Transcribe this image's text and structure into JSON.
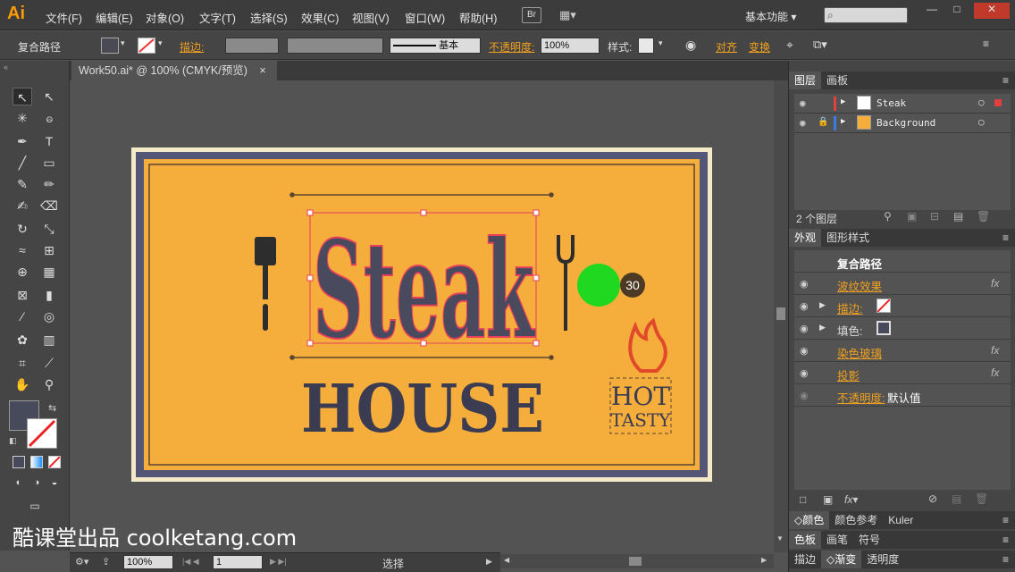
{
  "app": {
    "logo": "Ai",
    "document_tab": "Work50.ai* @ 100% (CMYK/预览)",
    "tab_close": "×"
  },
  "menu": [
    "文件(F)",
    "编辑(E)",
    "对象(O)",
    "文字(T)",
    "选择(S)",
    "效果(C)",
    "视图(V)",
    "窗口(W)",
    "帮助(H)"
  ],
  "menubar": {
    "bridge": "Br",
    "workspace": "基本功能",
    "search_placeholder": "",
    "min": "—",
    "max": "□",
    "close": "✕"
  },
  "control": {
    "selection_type": "复合路径",
    "stroke_label": "描边:",
    "stroke_profile": "基本",
    "opacity_label": "不透明度:",
    "opacity_value": "100%",
    "style_label": "样式:",
    "align_label": "对齐",
    "transform_label": "变换"
  },
  "artwork": {
    "title_word": "Steak",
    "subtitle": "HOUSE",
    "badge_line1": "HOT",
    "badge_line2": "TASTY"
  },
  "cursor_badge": "30",
  "colors": {
    "artboard_bg": "#f4e9c8",
    "poster_orange": "#f5ad3c",
    "poster_border": "#545675",
    "ink": "#3b3b52",
    "selection": "#e8405a",
    "cursor_green": "#1fd81f"
  },
  "statusbar": {
    "zoom": "100%",
    "page": "1",
    "mode": "选择"
  },
  "layers_panel": {
    "tabs": [
      "图层",
      "画板"
    ],
    "layers": [
      {
        "name": "Steak",
        "color": "#e04040"
      },
      {
        "name": "Background",
        "color": "#3a7ce0"
      }
    ],
    "count": "2 个图层"
  },
  "appearance_panel": {
    "tabs": [
      "外观",
      "图形样式"
    ],
    "header": "复合路径",
    "rows": [
      {
        "label": "波纹效果",
        "value": ""
      },
      {
        "label": "描边:",
        "value": ""
      },
      {
        "label": "填色:",
        "value": ""
      },
      {
        "label": "染色玻璃",
        "value": ""
      },
      {
        "label": "投影",
        "value": ""
      },
      {
        "label": "不透明度:",
        "value": "默认值"
      }
    ],
    "fx": "fx"
  },
  "collapsed_panels": [
    [
      "颜色",
      "颜色参考",
      "Kuler"
    ],
    [
      "色板",
      "画笔",
      "符号"
    ],
    [
      "描边",
      "渐变",
      "透明度"
    ]
  ],
  "watermark": "酷课堂出品 coolketang.com"
}
